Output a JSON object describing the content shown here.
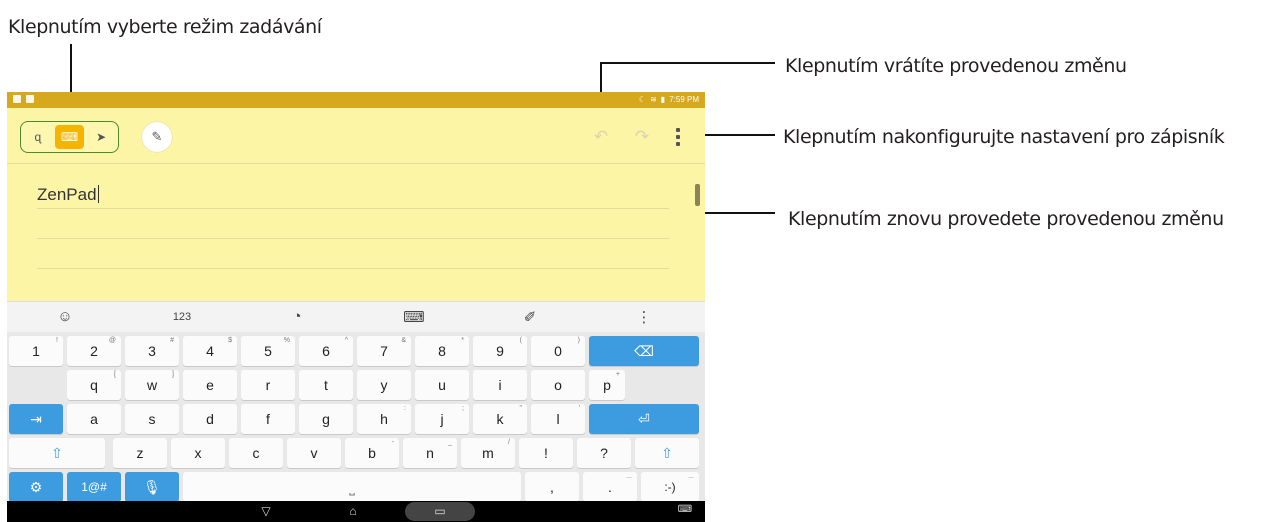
{
  "callouts": {
    "input_mode": "Klepnutím vyberte režim zadávání",
    "undo": "Klepnutím vrátíte provedenou změnu",
    "settings": "Klepnutím nakonfigurujte nastavení pro zápisník",
    "redo": "Klepnutím znovu provedete provedenou změnu"
  },
  "statusbar": {
    "time": "7:59 PM",
    "color": "#d5a81e"
  },
  "note": {
    "text": "ZenPad",
    "background": "#fdf5a6",
    "mode_buttons": [
      {
        "icon": "handwriting-icon",
        "glyph": "ɋ"
      },
      {
        "icon": "keyboard-icon",
        "glyph": "⌨",
        "active": true
      },
      {
        "icon": "brush-icon",
        "glyph": "➤"
      }
    ],
    "pen_glyph": "✎",
    "undo_glyph": "↶",
    "redo_glyph": "↷"
  },
  "toolbar": {
    "emoji": "☺",
    "numbers": "123",
    "palette": "◔",
    "keyboard": "⌨",
    "clipboard": "✐",
    "more": "⋮"
  },
  "keyboard": {
    "accent": "#3d9be0",
    "row1": [
      {
        "l": "1",
        "h": "!"
      },
      {
        "l": "2",
        "h": "@"
      },
      {
        "l": "3",
        "h": "#"
      },
      {
        "l": "4",
        "h": "$"
      },
      {
        "l": "5",
        "h": "%"
      },
      {
        "l": "6",
        "h": "^"
      },
      {
        "l": "7",
        "h": "&"
      },
      {
        "l": "8",
        "h": "*"
      },
      {
        "l": "9",
        "h": "("
      },
      {
        "l": "0",
        "h": ")"
      }
    ],
    "backspace": "⌫",
    "row2": [
      {
        "l": "q",
        "h": "["
      },
      {
        "l": "w",
        "h": "]"
      },
      {
        "l": "e",
        "h": ""
      },
      {
        "l": "r",
        "h": ""
      },
      {
        "l": "t",
        "h": ""
      },
      {
        "l": "y",
        "h": ""
      },
      {
        "l": "u",
        "h": ""
      },
      {
        "l": "i",
        "h": ""
      },
      {
        "l": "o",
        "h": ""
      },
      {
        "l": "p",
        "h": "+"
      }
    ],
    "tab": "⇥",
    "row3": [
      {
        "l": "a",
        "h": ""
      },
      {
        "l": "s",
        "h": ""
      },
      {
        "l": "d",
        "h": ""
      },
      {
        "l": "f",
        "h": ""
      },
      {
        "l": "g",
        "h": ""
      },
      {
        "l": "h",
        "h": ":"
      },
      {
        "l": "j",
        "h": ";"
      },
      {
        "l": "k",
        "h": "\""
      },
      {
        "l": "l",
        "h": "'"
      }
    ],
    "enter": "⏎",
    "shift": "⇧",
    "row4": [
      {
        "l": "z",
        "h": ""
      },
      {
        "l": "x",
        "h": ""
      },
      {
        "l": "c",
        "h": ""
      },
      {
        "l": "v",
        "h": ""
      },
      {
        "l": "b",
        "h": "-"
      },
      {
        "l": "n",
        "h": "_"
      },
      {
        "l": "m",
        "h": "/"
      },
      {
        "l": "!",
        "h": ""
      },
      {
        "l": "?",
        "h": ""
      }
    ],
    "settings": "⚙",
    "symbols": "1@#",
    "mic": "🎙",
    "space": "⎵",
    "comma": ",",
    "period": ".",
    "period_hint": "...",
    "smiley": ":-)",
    "smiley_hint": "..."
  },
  "navbar": {
    "back": "▽",
    "home": "⌂",
    "recents": "▭",
    "keyboard": "⌨"
  }
}
